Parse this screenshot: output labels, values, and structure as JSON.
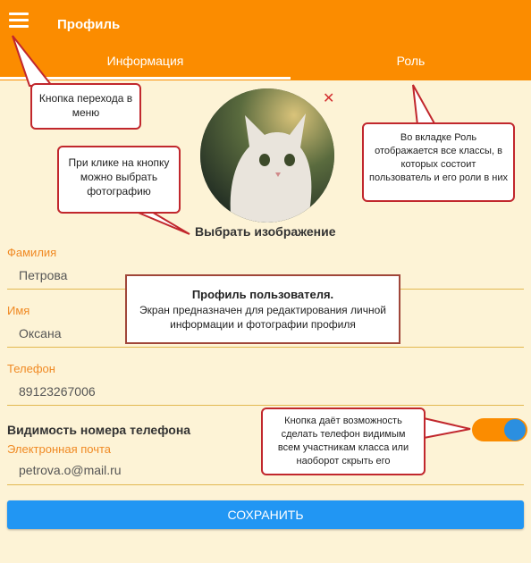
{
  "header": {
    "title": "Профиль"
  },
  "tabs": [
    "Информация",
    "Роль"
  ],
  "avatar": {
    "action_label": "Выбрать изображение"
  },
  "fields": [
    {
      "label": "Фамилия",
      "value": "Петрова"
    },
    {
      "label": "Имя",
      "value": "Оксана"
    },
    {
      "label": "Телефон",
      "value": "89123267006"
    },
    {
      "label": "Электронная почта",
      "value": "petrova.o@mail.ru"
    }
  ],
  "phone_visibility": {
    "label": "Видимость номера телефона",
    "enabled": true
  },
  "save_label": "СОХРАНИТЬ",
  "annotations": {
    "menu": "Кнопка перехода в меню",
    "photo": "При клике на кнопку можно выбрать фотографию",
    "role": "Во вкладке Роль отображается все классы, в которых состоит пользователь и его роли в них",
    "center_title": "Профиль пользователя.",
    "center_text": "Экран предназначен для редактирования личной информации и фотографии профиля",
    "toggle": "Кнопка даёт возможность сделать телефон видимым всем участникам класса или наоборот скрыть его"
  },
  "colors": {
    "header": "#fb8c00",
    "accent_label": "#f08a24",
    "save": "#2196f3",
    "callout_border": "#c1272d"
  }
}
